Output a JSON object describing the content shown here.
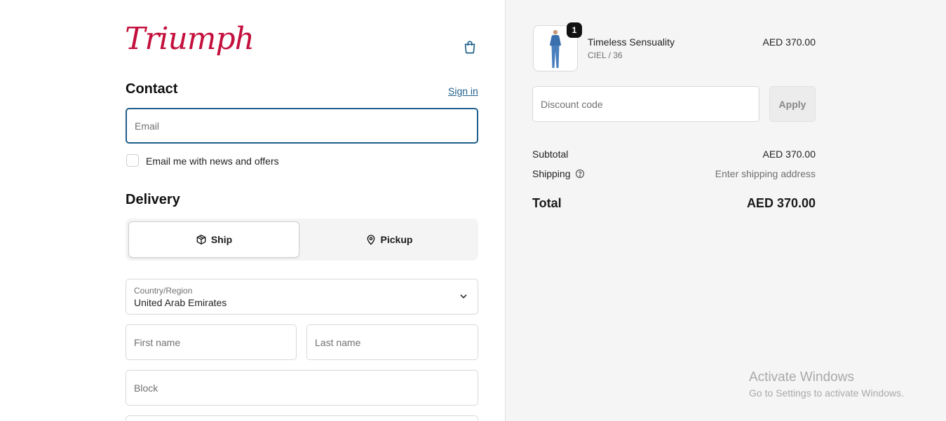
{
  "brand": {
    "logo_text": "Triumph",
    "accent": "#c3103d",
    "link_color": "#1f5f8b"
  },
  "header": {
    "cart_icon": "shopping-bag-icon"
  },
  "contact": {
    "title": "Contact",
    "sign_in": "Sign in",
    "email_placeholder": "Email",
    "newsletter_label": "Email me with news and offers"
  },
  "delivery": {
    "title": "Delivery",
    "options": [
      {
        "label": "Ship",
        "icon": "package-icon",
        "selected": true
      },
      {
        "label": "Pickup",
        "icon": "location-pin-icon",
        "selected": false
      }
    ],
    "country_label": "Country/Region",
    "country_value": "United Arab Emirates",
    "first_name_placeholder": "First name",
    "last_name_placeholder": "Last name",
    "block_placeholder": "Block"
  },
  "summary": {
    "item": {
      "name": "Timeless Sensuality",
      "variant": "CIEL / 36",
      "price": "AED 370.00",
      "quantity": "1"
    },
    "discount_placeholder": "Discount code",
    "apply_label": "Apply",
    "subtotal_label": "Subtotal",
    "subtotal_value": "AED 370.00",
    "shipping_label": "Shipping",
    "shipping_value": "Enter shipping address",
    "total_label": "Total",
    "total_value": "AED 370.00"
  },
  "watermark": {
    "line1": "Activate Windows",
    "line2": "Go to Settings to activate Windows."
  }
}
